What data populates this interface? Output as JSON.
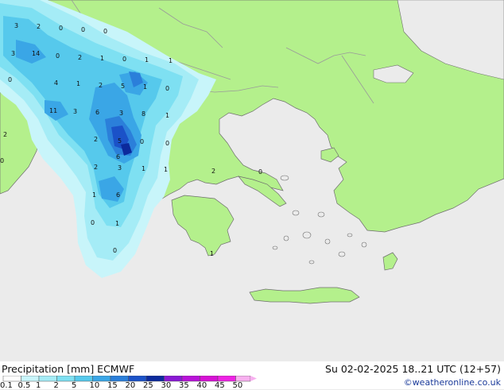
{
  "header": {
    "title": "Precipitation [mm]  ECMWF",
    "valid_time": "Su 02-02-2025 18..21 UTC (12+57)",
    "copyright": "©weatheronline.co.uk"
  },
  "legend": {
    "labels": [
      "0.1",
      "0.5",
      "1",
      "2",
      "5",
      "10",
      "15",
      "20",
      "25",
      "30",
      "35",
      "40",
      "45",
      "50"
    ],
    "colors": [
      "#ffffff",
      "#c8f5fa",
      "#a5ecf6",
      "#7ee0f2",
      "#56c9ec",
      "#3aa6e6",
      "#2b7fda",
      "#1b52c8",
      "#0c2a9c",
      "#8a18d4",
      "#b812d8",
      "#d611d4",
      "#ee22e4",
      "#f7b0ef"
    ]
  },
  "map": {
    "colors": {
      "land": "#b4f08c",
      "sea": "#ebebeb",
      "border": "#9a9a9a",
      "coast": "#6e6e6e"
    },
    "values": [
      "3",
      "2",
      "0",
      "0",
      "0",
      "3",
      "14",
      "0",
      "2",
      "1",
      "0",
      "1",
      "1",
      "0",
      "4",
      "1",
      "2",
      "5",
      "1",
      "0",
      "11",
      "3",
      "6",
      "3",
      "8",
      "1",
      "2",
      "2",
      "5",
      "0",
      "0",
      "0",
      "6",
      "2",
      "3",
      "1",
      "1",
      "2",
      "0",
      "1",
      "6",
      "0",
      "1",
      "0",
      "1"
    ]
  }
}
